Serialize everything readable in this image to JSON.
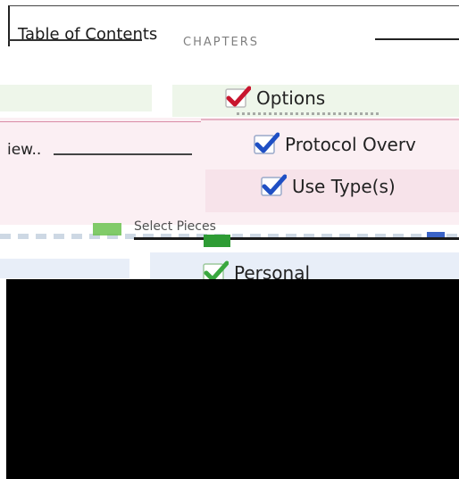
{
  "header": {
    "title": "Table of Contents",
    "ghost_text": "CHAPTERS"
  },
  "fragments": {
    "left_view": "iew.."
  },
  "tree": {
    "options": {
      "label": "Options",
      "checked": true,
      "check_color": "#c8152e"
    },
    "protocol": {
      "label": "Protocol Overv",
      "checked": true,
      "check_color": "#1f4fc4"
    },
    "use_type": {
      "label": "Use Type(s)",
      "checked": true,
      "check_color": "#1f4fc4"
    },
    "personal": {
      "label": "Personal",
      "checked": true,
      "check_color": "#3aa83f"
    },
    "middle_label": "Select Pieces"
  },
  "colors": {
    "band_green": "#eef6ea",
    "band_pink": "#fbeff3",
    "band_blue": "#e8eef8",
    "occluder": "#000000"
  }
}
